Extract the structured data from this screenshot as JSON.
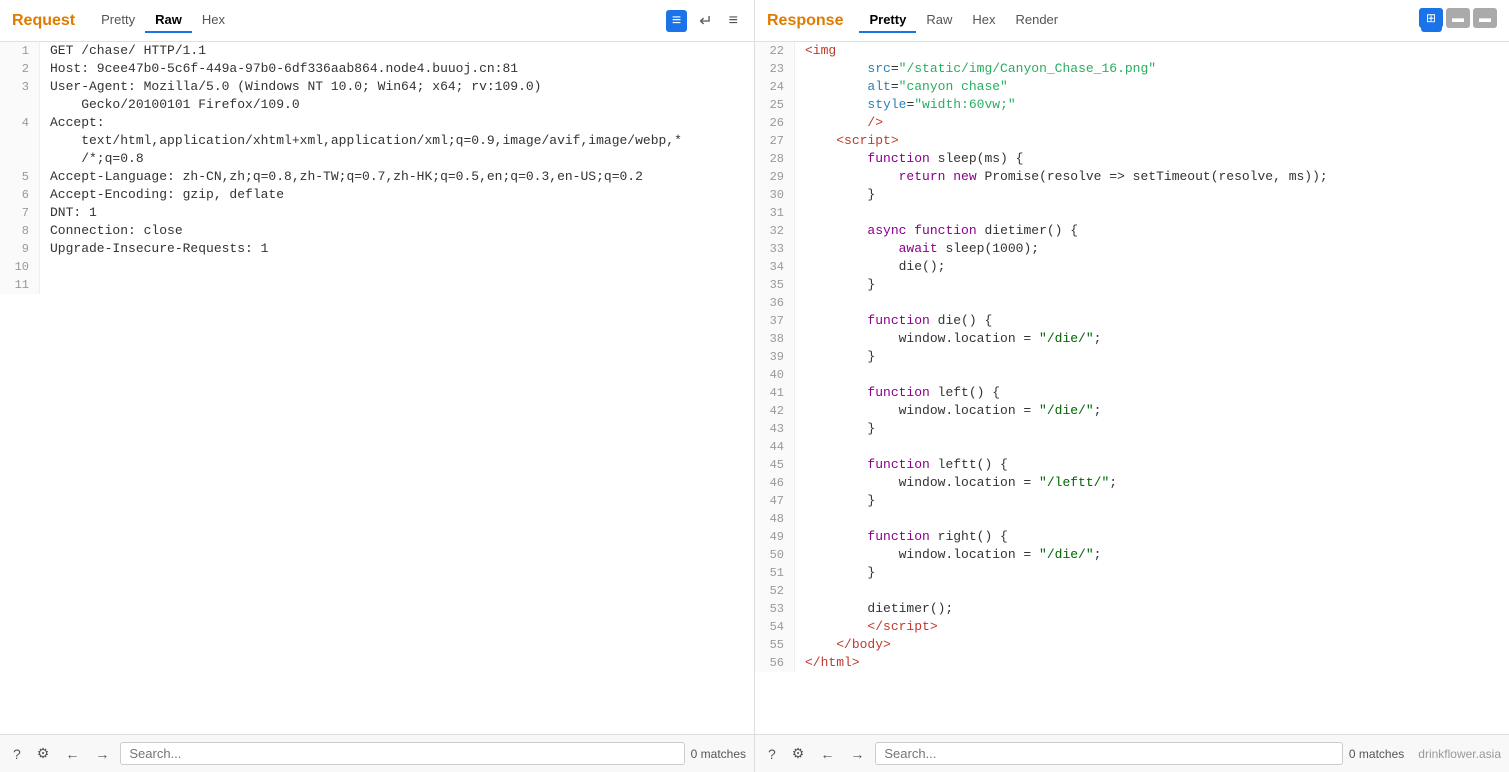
{
  "top_icons": {
    "split_label": "⊞",
    "col1_label": "▬",
    "col2_label": "▬"
  },
  "request_panel": {
    "title": "Request",
    "tabs": [
      {
        "label": "Pretty",
        "active": false
      },
      {
        "label": "Raw",
        "active": true
      },
      {
        "label": "Hex",
        "active": false
      }
    ],
    "format_btn": "≡",
    "wrap_btn": "↵",
    "menu_btn": "≡",
    "lines": [
      {
        "num": 1,
        "text": "GET /chase/ HTTP/1.1"
      },
      {
        "num": 2,
        "text": "Host: 9cee47b0-5c6f-449a-97b0-6df336aab864.node4.buuoj.cn:81"
      },
      {
        "num": 3,
        "text": "User-Agent: Mozilla/5.0 (Windows NT 10.0; Win64; x64; rv:109.0)"
      },
      {
        "num": "",
        "text": "    Gecko/20100101 Firefox/109.0"
      },
      {
        "num": 4,
        "text": "Accept:"
      },
      {
        "num": "",
        "text": "    text/html,application/xhtml+xml,application/xml;q=0.9,image/avif,image/webp,*"
      },
      {
        "num": "",
        "text": "    /*;q=0.8"
      },
      {
        "num": 5,
        "text": "Accept-Language: zh-CN,zh;q=0.8,zh-TW;q=0.7,zh-HK;q=0.5,en;q=0.3,en-US;q=0.2"
      },
      {
        "num": 6,
        "text": "Accept-Encoding: gzip, deflate"
      },
      {
        "num": 7,
        "text": "DNT: 1"
      },
      {
        "num": 8,
        "text": "Connection: close"
      },
      {
        "num": 9,
        "text": "Upgrade-Insecure-Requests: 1"
      },
      {
        "num": 10,
        "text": ""
      },
      {
        "num": 11,
        "text": ""
      }
    ],
    "search_placeholder": "Search...",
    "match_count": "0 matches"
  },
  "response_panel": {
    "title": "Response",
    "tabs": [
      {
        "label": "Pretty",
        "active": true
      },
      {
        "label": "Raw",
        "active": false
      },
      {
        "label": "Hex",
        "active": false
      },
      {
        "label": "Render",
        "active": false
      }
    ],
    "format_btn": "≡",
    "wrap_btn": "↵",
    "menu_btn": "≡",
    "lines": [
      {
        "num": 22,
        "type": "html",
        "parts": [
          {
            "type": "indent",
            "text": "    "
          },
          {
            "type": "tag",
            "text": "<img"
          }
        ]
      },
      {
        "num": 23,
        "type": "html",
        "parts": [
          {
            "type": "indent",
            "text": "        "
          },
          {
            "type": "attr-name",
            "text": "src"
          },
          {
            "type": "plain",
            "text": "="
          },
          {
            "type": "attr-val",
            "text": "\"/static/img/Canyon_Chase_16.png\""
          }
        ]
      },
      {
        "num": 24,
        "type": "html",
        "parts": [
          {
            "type": "indent",
            "text": "        "
          },
          {
            "type": "attr-name",
            "text": "alt"
          },
          {
            "type": "plain",
            "text": "="
          },
          {
            "type": "attr-val",
            "text": "\"canyon chase\""
          }
        ]
      },
      {
        "num": 25,
        "type": "html",
        "parts": [
          {
            "type": "indent",
            "text": "        "
          },
          {
            "type": "attr-name",
            "text": "style"
          },
          {
            "type": "plain",
            "text": "="
          },
          {
            "type": "attr-val",
            "text": "\"width:60vw;\""
          }
        ]
      },
      {
        "num": 26,
        "type": "html",
        "parts": [
          {
            "type": "indent",
            "text": "        "
          },
          {
            "type": "tag",
            "text": "/>"
          }
        ]
      },
      {
        "num": 27,
        "type": "html",
        "parts": [
          {
            "type": "indent",
            "text": "    "
          },
          {
            "type": "tag",
            "text": "<script>"
          }
        ]
      },
      {
        "num": 28,
        "type": "js",
        "parts": [
          {
            "type": "indent",
            "text": "        "
          },
          {
            "type": "keyword",
            "text": "function"
          },
          {
            "type": "plain",
            "text": " sleep(ms) {"
          }
        ]
      },
      {
        "num": 29,
        "type": "js",
        "parts": [
          {
            "type": "indent",
            "text": "            "
          },
          {
            "type": "keyword",
            "text": "return"
          },
          {
            "type": "plain",
            "text": " "
          },
          {
            "type": "keyword",
            "text": "new"
          },
          {
            "type": "plain",
            "text": " Promise(resolve => setTimeout(resolve, ms));"
          }
        ]
      },
      {
        "num": 30,
        "type": "js",
        "parts": [
          {
            "type": "indent",
            "text": "        "
          },
          {
            "type": "plain",
            "text": "}"
          }
        ]
      },
      {
        "num": 31,
        "type": "js",
        "parts": [
          {
            "type": "plain",
            "text": ""
          }
        ]
      },
      {
        "num": 32,
        "type": "js",
        "parts": [
          {
            "type": "indent",
            "text": "        "
          },
          {
            "type": "keyword",
            "text": "async"
          },
          {
            "type": "plain",
            "text": " "
          },
          {
            "type": "keyword",
            "text": "function"
          },
          {
            "type": "plain",
            "text": " dietimer() {"
          }
        ]
      },
      {
        "num": 33,
        "type": "js",
        "parts": [
          {
            "type": "indent",
            "text": "            "
          },
          {
            "type": "keyword",
            "text": "await"
          },
          {
            "type": "plain",
            "text": " sleep(1000);"
          }
        ]
      },
      {
        "num": 34,
        "type": "js",
        "parts": [
          {
            "type": "indent",
            "text": "            "
          },
          {
            "type": "plain",
            "text": "die();"
          }
        ]
      },
      {
        "num": 35,
        "type": "js",
        "parts": [
          {
            "type": "indent",
            "text": "        "
          },
          {
            "type": "plain",
            "text": "}"
          }
        ]
      },
      {
        "num": 36,
        "type": "js",
        "parts": [
          {
            "type": "plain",
            "text": ""
          }
        ]
      },
      {
        "num": 37,
        "type": "js",
        "parts": [
          {
            "type": "indent",
            "text": "        "
          },
          {
            "type": "keyword",
            "text": "function"
          },
          {
            "type": "plain",
            "text": " die() {"
          }
        ]
      },
      {
        "num": 38,
        "type": "js",
        "parts": [
          {
            "type": "indent",
            "text": "            "
          },
          {
            "type": "plain",
            "text": "window.location = "
          },
          {
            "type": "string",
            "text": "\"/die/\""
          },
          {
            "type": "plain",
            "text": ";"
          }
        ]
      },
      {
        "num": 39,
        "type": "js",
        "parts": [
          {
            "type": "indent",
            "text": "        "
          },
          {
            "type": "plain",
            "text": "}"
          }
        ]
      },
      {
        "num": 40,
        "type": "js",
        "parts": [
          {
            "type": "plain",
            "text": ""
          }
        ]
      },
      {
        "num": 41,
        "type": "js",
        "parts": [
          {
            "type": "indent",
            "text": "        "
          },
          {
            "type": "keyword",
            "text": "function"
          },
          {
            "type": "plain",
            "text": " left() {"
          }
        ]
      },
      {
        "num": 42,
        "type": "js",
        "parts": [
          {
            "type": "indent",
            "text": "            "
          },
          {
            "type": "plain",
            "text": "window.location = "
          },
          {
            "type": "string",
            "text": "\"/die/\""
          },
          {
            "type": "plain",
            "text": ";"
          }
        ]
      },
      {
        "num": 43,
        "type": "js",
        "parts": [
          {
            "type": "indent",
            "text": "        "
          },
          {
            "type": "plain",
            "text": "}"
          }
        ]
      },
      {
        "num": 44,
        "type": "js",
        "parts": [
          {
            "type": "plain",
            "text": ""
          }
        ]
      },
      {
        "num": 45,
        "type": "js",
        "parts": [
          {
            "type": "indent",
            "text": "        "
          },
          {
            "type": "keyword",
            "text": "function"
          },
          {
            "type": "plain",
            "text": " leftt() {"
          }
        ]
      },
      {
        "num": 46,
        "type": "js",
        "parts": [
          {
            "type": "indent",
            "text": "            "
          },
          {
            "type": "plain",
            "text": "window.location = "
          },
          {
            "type": "string",
            "text": "\"/leftt/\""
          },
          {
            "type": "plain",
            "text": ";"
          }
        ]
      },
      {
        "num": 47,
        "type": "js",
        "parts": [
          {
            "type": "indent",
            "text": "        "
          },
          {
            "type": "plain",
            "text": "}"
          }
        ]
      },
      {
        "num": 48,
        "type": "js",
        "parts": [
          {
            "type": "plain",
            "text": ""
          }
        ]
      },
      {
        "num": 49,
        "type": "js",
        "parts": [
          {
            "type": "indent",
            "text": "        "
          },
          {
            "type": "keyword",
            "text": "function"
          },
          {
            "type": "plain",
            "text": " right() {"
          }
        ]
      },
      {
        "num": 50,
        "type": "js",
        "parts": [
          {
            "type": "indent",
            "text": "            "
          },
          {
            "type": "plain",
            "text": "window.location = "
          },
          {
            "type": "string",
            "text": "\"/die/\""
          },
          {
            "type": "plain",
            "text": ";"
          }
        ]
      },
      {
        "num": 51,
        "type": "js",
        "parts": [
          {
            "type": "indent",
            "text": "        "
          },
          {
            "type": "plain",
            "text": "}"
          }
        ]
      },
      {
        "num": 52,
        "type": "js",
        "parts": [
          {
            "type": "plain",
            "text": ""
          }
        ]
      },
      {
        "num": 53,
        "type": "js",
        "parts": [
          {
            "type": "indent",
            "text": "        "
          },
          {
            "type": "plain",
            "text": "dietimer();"
          }
        ]
      },
      {
        "num": 54,
        "type": "html",
        "parts": [
          {
            "type": "indent",
            "text": "        "
          },
          {
            "type": "tag",
            "text": "</"
          },
          {
            "type": "tag",
            "text": "script"
          },
          {
            "type": "tag",
            "text": ">"
          }
        ]
      },
      {
        "num": 55,
        "type": "html",
        "parts": [
          {
            "type": "indent",
            "text": "    "
          },
          {
            "type": "tag",
            "text": "</body>"
          }
        ]
      },
      {
        "num": 56,
        "type": "html",
        "parts": [
          {
            "type": "tag",
            "text": "</html>"
          }
        ]
      }
    ],
    "search_placeholder": "Search...",
    "match_count": "0 matches",
    "watermark": "drinkflower.asia"
  }
}
